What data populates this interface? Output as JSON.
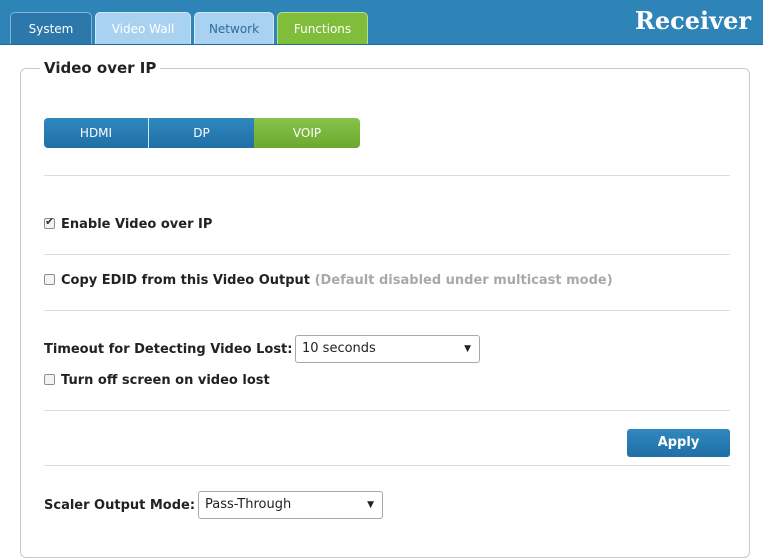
{
  "header": {
    "tabs": [
      {
        "label": "System"
      },
      {
        "label": "Video Wall"
      },
      {
        "label": "Network"
      },
      {
        "label": "Functions"
      }
    ],
    "brand": "Receiver"
  },
  "section": {
    "title": "Video over IP",
    "segments": [
      {
        "label": "HDMI"
      },
      {
        "label": "DP"
      },
      {
        "label": "VOIP"
      }
    ]
  },
  "options": {
    "enable_voip": {
      "label": "Enable Video over IP",
      "checked": true
    },
    "copy_edid": {
      "label": "Copy EDID from this Video Output",
      "note": "(Default disabled under multicast mode)",
      "checked": false
    },
    "timeout_label": "Timeout for Detecting Video Lost:",
    "timeout_value": "10 seconds",
    "turn_off_screen": {
      "label": "Turn off screen on video lost",
      "checked": false
    },
    "apply_label": "Apply",
    "scaler_label": "Scaler Output Mode:",
    "scaler_value": "Pass-Through"
  },
  "icons": {
    "dropdown": "chevron-down-icon",
    "checkbox": "checkbox-icon"
  },
  "colors": {
    "header": "#2e83b7",
    "active_tab": "#7fbd3b",
    "segment_blue": "#2f88bf",
    "segment_active": "#88c34b"
  }
}
